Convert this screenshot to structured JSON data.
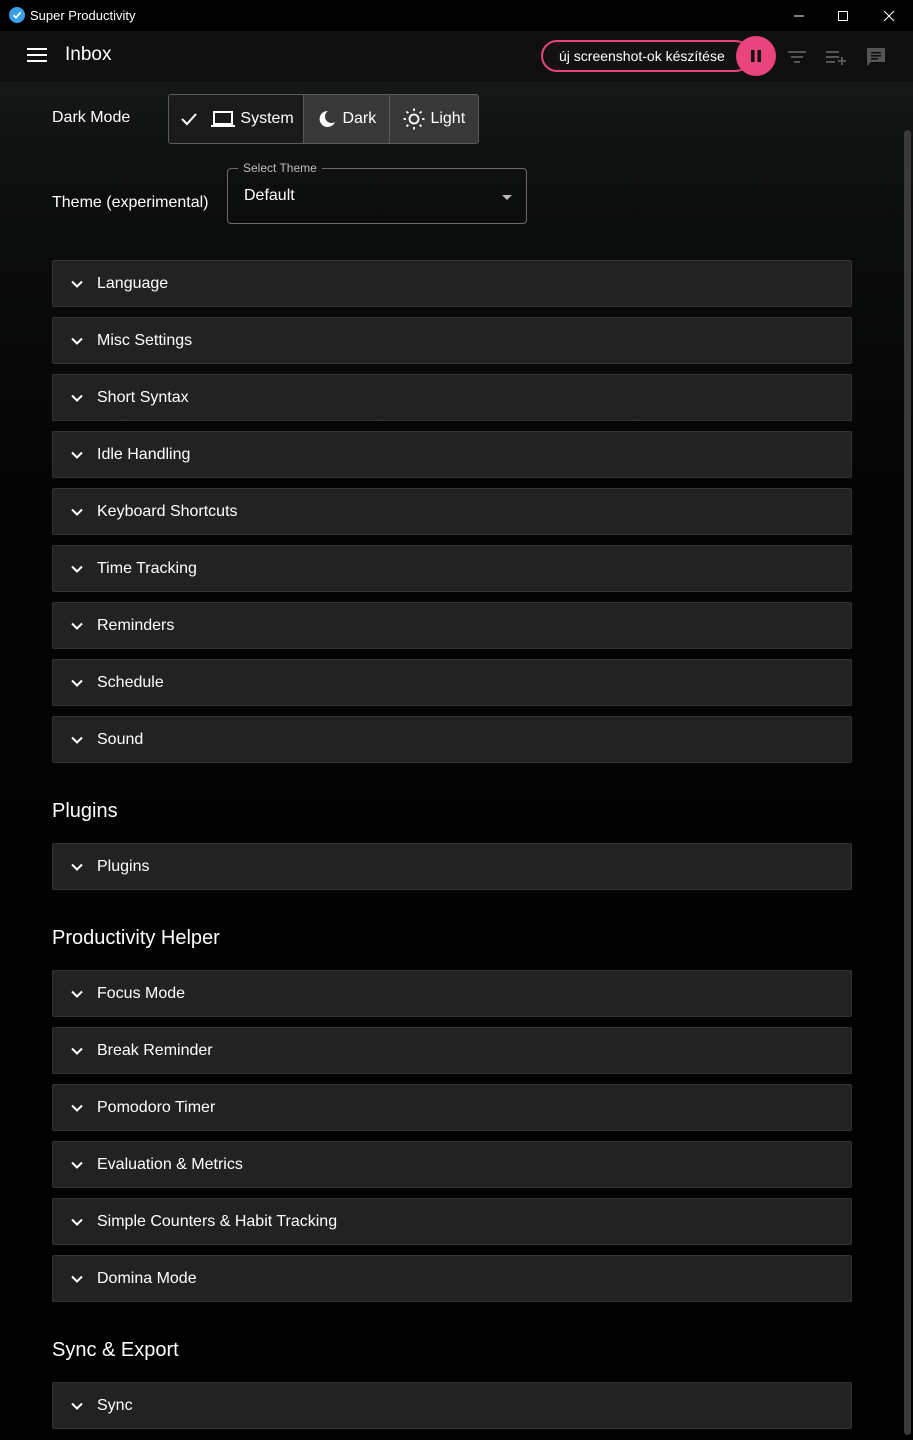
{
  "window": {
    "title": "Super Productivity"
  },
  "header": {
    "title": "Inbox",
    "record_label": "új screenshot-ok készítése"
  },
  "settings": {
    "dark_mode_label": "Dark Mode",
    "dark_mode_options": [
      "System",
      "Dark",
      "Light"
    ],
    "dark_mode_selected": "System",
    "theme_label": "Theme (experimental)",
    "theme_select_legend": "Select Theme",
    "theme_select_value": "Default"
  },
  "panels_general": [
    "Language",
    "Misc Settings",
    "Short Syntax",
    "Idle Handling",
    "Keyboard Shortcuts",
    "Time Tracking",
    "Reminders",
    "Schedule",
    "Sound"
  ],
  "sections": {
    "plugins": {
      "title": "Plugins",
      "panels": [
        "Plugins"
      ]
    },
    "productivity": {
      "title": "Productivity Helper",
      "panels": [
        "Focus Mode",
        "Break Reminder",
        "Pomodoro Timer",
        "Evaluation & Metrics",
        "Simple Counters & Habit Tracking",
        "Domina Mode"
      ]
    },
    "sync": {
      "title": "Sync & Export",
      "panels": [
        "Sync"
      ]
    }
  },
  "colors": {
    "accent": "#e9447d",
    "panel_bg": "#222222",
    "app_icon": "#3aa0e8"
  }
}
